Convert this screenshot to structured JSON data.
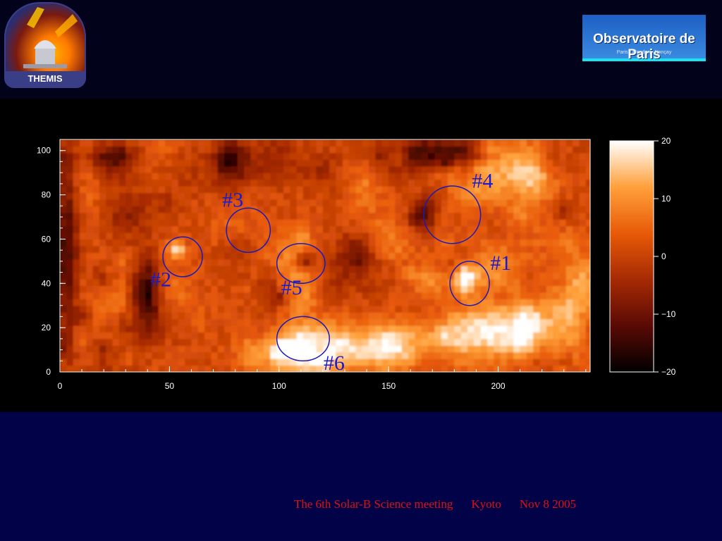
{
  "logos": {
    "left_text": "THEMIS",
    "right_text": "Observatoire de Paris",
    "right_subtext": "Paris • Meudon • Nançay"
  },
  "chart_data": {
    "type": "heatmap",
    "title": "",
    "xlabel": "",
    "ylabel": "",
    "xlim": [
      0,
      242
    ],
    "ylim": [
      0,
      105
    ],
    "xticks": [
      0,
      50,
      100,
      150,
      200
    ],
    "yticks": [
      0,
      20,
      40,
      60,
      80,
      100
    ],
    "colorbar": {
      "range": [
        -20,
        20
      ],
      "ticks": [
        20,
        10,
        0,
        -10,
        -20
      ],
      "tick_labels": [
        "20",
        "10",
        "0",
        "−10",
        "−20"
      ],
      "colormap": [
        "#000000",
        "#5a0a04",
        "#a62a04",
        "#e85a08",
        "#ffa03a",
        "#ffffff"
      ]
    },
    "annotations": [
      {
        "label": "#1",
        "x": 187,
        "y": 40,
        "rx": 9,
        "ry": 10
      },
      {
        "label": "#2",
        "x": 56,
        "y": 52,
        "rx": 9,
        "ry": 9
      },
      {
        "label": "#3",
        "x": 86,
        "y": 64,
        "rx": 10,
        "ry": 10
      },
      {
        "label": "#4",
        "x": 179,
        "y": 71,
        "rx": 13,
        "ry": 13
      },
      {
        "label": "#5",
        "x": 110,
        "y": 49,
        "rx": 11,
        "ry": 9
      },
      {
        "label": "#6",
        "x": 111,
        "y": 15,
        "rx": 12,
        "ry": 10
      }
    ]
  },
  "footer": {
    "meeting": "The 6th Solar-B Science meeting",
    "place": "Kyoto",
    "date": "Nov 8 2005"
  }
}
